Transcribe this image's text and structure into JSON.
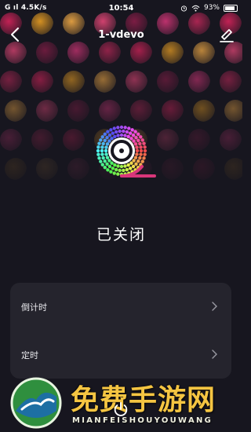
{
  "status_bar": {
    "left": "G ıl 4.5K/s",
    "time": "10:54",
    "battery": "93%",
    "icons": [
      "alarm-icon",
      "wifi-icon",
      "battery-icon"
    ]
  },
  "header": {
    "title": "1-vdevo",
    "back_icon": "back-chevron-icon",
    "edit_icon": "edit-icon"
  },
  "device": {
    "state_label": "已关闭",
    "logo_icon": "rainbow-ring-logo"
  },
  "menu": {
    "items": [
      {
        "label": "倒计时",
        "icon": "chevron-right-icon"
      },
      {
        "label": "定时",
        "icon": "chevron-right-icon"
      }
    ]
  },
  "power_icon": "power-icon",
  "watermark": {
    "title": "免费手游网",
    "subtitle": "MIANFEISHOUYOUWANG"
  },
  "colors": {
    "background": "#17161f",
    "card": "#25242d",
    "dot_palette": [
      "#e0245e",
      "#d9367a",
      "#f0497c",
      "#f5a623",
      "#c2285a",
      "#8e1e4a",
      "#ffb347"
    ]
  }
}
